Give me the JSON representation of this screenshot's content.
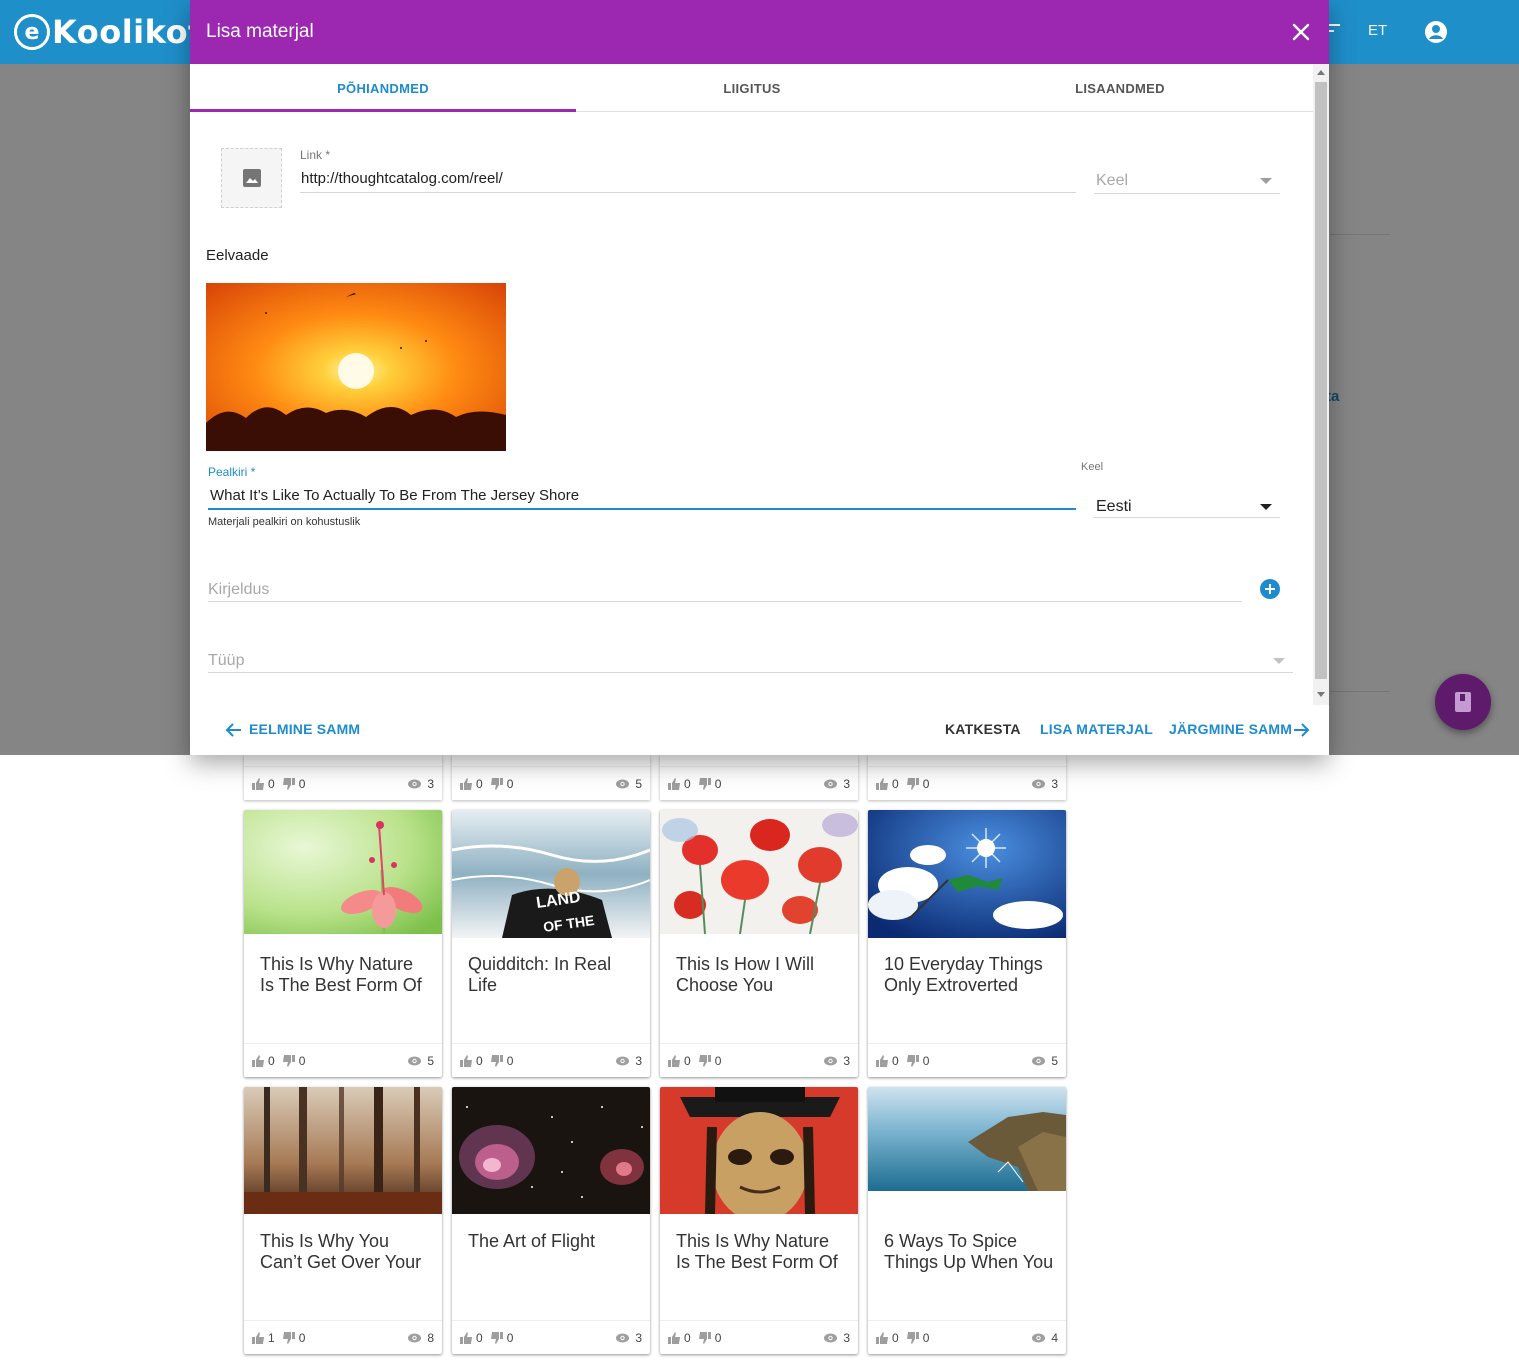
{
  "app": {
    "logo_text": "Koolikott",
    "logo_letter": "e",
    "language": "ET",
    "background_link_text": "ta"
  },
  "dialog": {
    "title": "Lisa materjal",
    "tabs": [
      {
        "label": "PÕHIANDMED",
        "active": true
      },
      {
        "label": "LIIGITUS",
        "active": false
      },
      {
        "label": "LISAANDMED",
        "active": false
      }
    ],
    "link": {
      "label": "Link *",
      "value": "http://thoughtcatalog.com/reel/"
    },
    "link_language": {
      "placeholder": "Keel"
    },
    "preview_label": "Eelvaade",
    "title_field": {
      "label": "Pealkiri *",
      "value": "What It’s Like To Actually To Be From The Jersey Shore",
      "helper": "Materjali pealkiri on kohustuslik"
    },
    "title_language": {
      "label": "Keel",
      "value": "Eesti"
    },
    "description": {
      "placeholder": "Kirjeldus"
    },
    "type": {
      "placeholder": "Tüüp"
    },
    "actions": {
      "previous": "EELMINE SAMM",
      "cancel": "KATKESTA",
      "add": "LISA MATERJAL",
      "next": "JÄRGMINE SAMM"
    }
  },
  "top_card_footers": [
    {
      "likes": "0",
      "dislikes": "0",
      "views": "3"
    },
    {
      "likes": "0",
      "dislikes": "0",
      "views": "5"
    },
    {
      "likes": "0",
      "dislikes": "0",
      "views": "3"
    },
    {
      "likes": "0",
      "dislikes": "0",
      "views": "3"
    }
  ],
  "cards": [
    {
      "title": "This Is Why Nature Is The Best Form Of",
      "likes": "0",
      "dislikes": "0",
      "views": "5",
      "image": "pink-flower"
    },
    {
      "title": "Quidditch: In Real Life",
      "likes": "0",
      "dislikes": "0",
      "views": "3",
      "image": "person-at-sea"
    },
    {
      "title": "This Is How I Will Choose You",
      "likes": "0",
      "dislikes": "0",
      "views": "3",
      "image": "poppies-watercolor"
    },
    {
      "title": "10 Everyday Things Only Extroverted",
      "likes": "0",
      "dislikes": "0",
      "views": "5",
      "image": "sky-sun-flag"
    },
    {
      "title": "This Is Why You Can’t Get Over Your",
      "likes": "1",
      "dislikes": "0",
      "views": "8",
      "image": "foggy-forest"
    },
    {
      "title": "The Art of Flight",
      "likes": "0",
      "dislikes": "0",
      "views": "3",
      "image": "nebula"
    },
    {
      "title": "This Is Why Nature Is The Best Form Of",
      "likes": "0",
      "dislikes": "0",
      "views": "3",
      "image": "painted-portrait"
    },
    {
      "title": "6 Ways To Spice Things Up When You",
      "likes": "0",
      "dislikes": "0",
      "views": "4",
      "image": "coastline"
    }
  ],
  "colors": {
    "header_blue": "#1f8fca",
    "dialog_purple": "#9c27b0",
    "accent_blue": "#1e8ccc",
    "fab": "#5e1a6b"
  }
}
